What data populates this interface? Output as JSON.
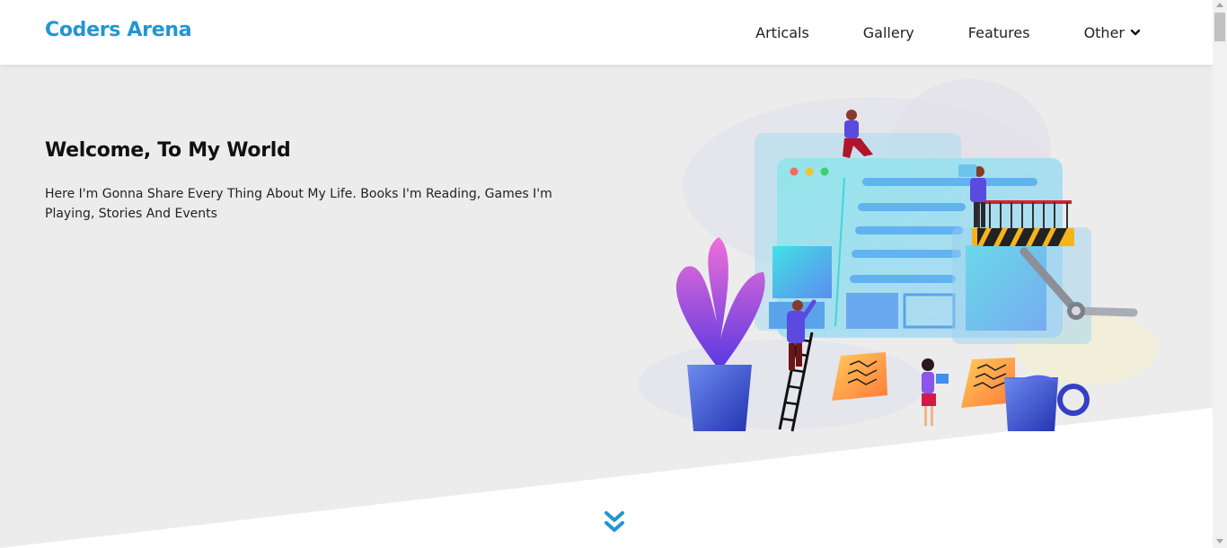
{
  "header": {
    "logo": "Coders Arena",
    "nav": [
      {
        "label": "Articals"
      },
      {
        "label": "Gallery"
      },
      {
        "label": "Features"
      },
      {
        "label": "Other",
        "icon": "chevron-down-icon"
      }
    ]
  },
  "hero": {
    "title": "Welcome, To My World",
    "text": "Here I'm Gonna Share Every Thing About My Life. Books I'm Reading, Games I'm Playing, Stories And Events",
    "illustration": "website-construction-illustration"
  },
  "scroll_down": {
    "icon": "double-chevron-down-icon"
  },
  "colors": {
    "brand": "#2196d3",
    "hero_bg": "#ececec",
    "text": "#111111"
  }
}
